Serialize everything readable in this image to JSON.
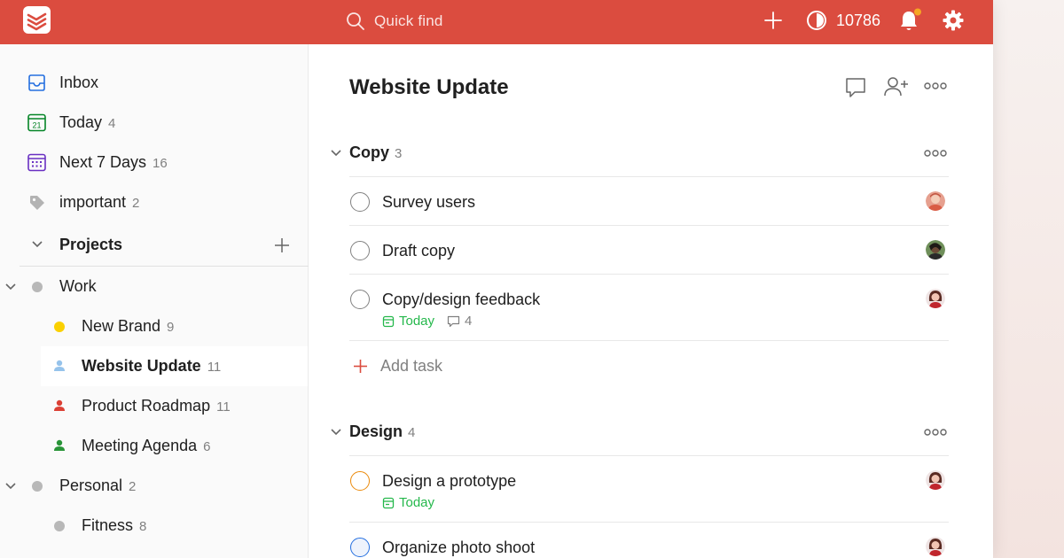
{
  "topbar": {
    "search_placeholder": "Quick find",
    "karma": "10786",
    "colors": {
      "brand": "#db4c3f",
      "notification": "#f5a623"
    },
    "icons": [
      "todoist-logo-icon",
      "search-icon",
      "plus-icon",
      "karma-icon",
      "bell-icon",
      "gear-icon"
    ]
  },
  "sidebar": {
    "inbox": {
      "label": "Inbox"
    },
    "today": {
      "label": "Today",
      "count": "4",
      "icon_text": "21"
    },
    "next7": {
      "label": "Next 7 Days",
      "count": "16"
    },
    "important": {
      "label": "important",
      "count": "2"
    },
    "projects_header": "Projects",
    "projects": {
      "work": {
        "label": "Work",
        "color": "#b8b8b8"
      },
      "new_brand": {
        "label": "New Brand",
        "count": "9",
        "color": "#fad000"
      },
      "website_update": {
        "label": "Website Update",
        "count": "11",
        "color": "#96c3eb"
      },
      "product_roadmap": {
        "label": "Product Roadmap",
        "count": "11",
        "color": "#db4035"
      },
      "meeting_agenda": {
        "label": "Meeting Agenda",
        "count": "6",
        "color": "#299438"
      },
      "personal": {
        "label": "Personal",
        "count": "2",
        "color": "#b8b8b8"
      },
      "fitness": {
        "label": "Fitness",
        "count": "8",
        "color": "#b8b8b8"
      }
    }
  },
  "main": {
    "title": "Website Update",
    "sections": [
      {
        "name": "Copy",
        "count": "3",
        "tasks": [
          {
            "label": "Survey users"
          },
          {
            "label": "Draft copy"
          },
          {
            "label": "Copy/design feedback",
            "due": "Today",
            "comments": "4"
          }
        ],
        "add_task_label": "Add task"
      },
      {
        "name": "Design",
        "count": "4",
        "tasks": [
          {
            "label": "Design a prototype",
            "due": "Today",
            "priority_color": "#eb8909"
          },
          {
            "label": "Organize photo shoot",
            "priority_color": "#246fe0"
          }
        ]
      }
    ]
  }
}
